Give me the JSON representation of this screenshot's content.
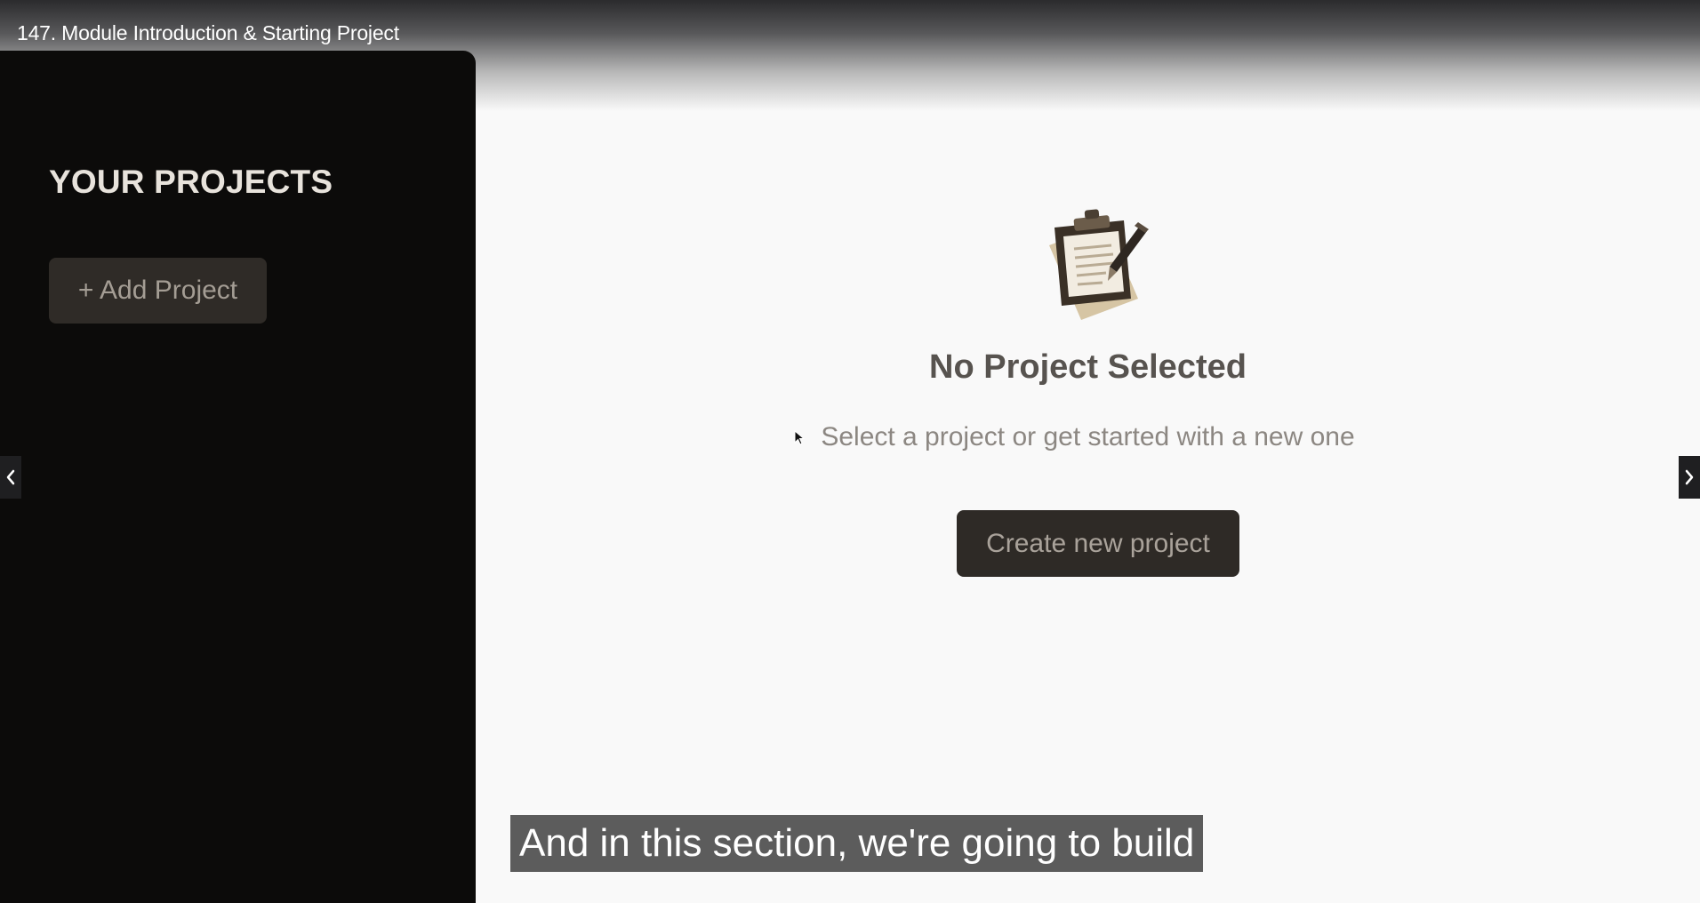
{
  "video": {
    "title": "147. Module Introduction & Starting Project"
  },
  "sidebar": {
    "title": "YOUR PROJECTS",
    "add_button_label": "+ Add Project"
  },
  "main": {
    "empty_state": {
      "icon": "clipboard-icon",
      "title": "No Project Selected",
      "description": "Select a project or get started with a new one",
      "create_button_label": "Create new project"
    }
  },
  "player": {
    "caption": "And in this section, we're going to build",
    "prev_icon": "chevron-left-icon",
    "next_icon": "chevron-right-icon"
  },
  "colors": {
    "sidebar_bg": "#0c0b0a",
    "button_bg": "#2f2b27",
    "main_bg": "#f9f9f9",
    "heading_text": "#57534f"
  }
}
